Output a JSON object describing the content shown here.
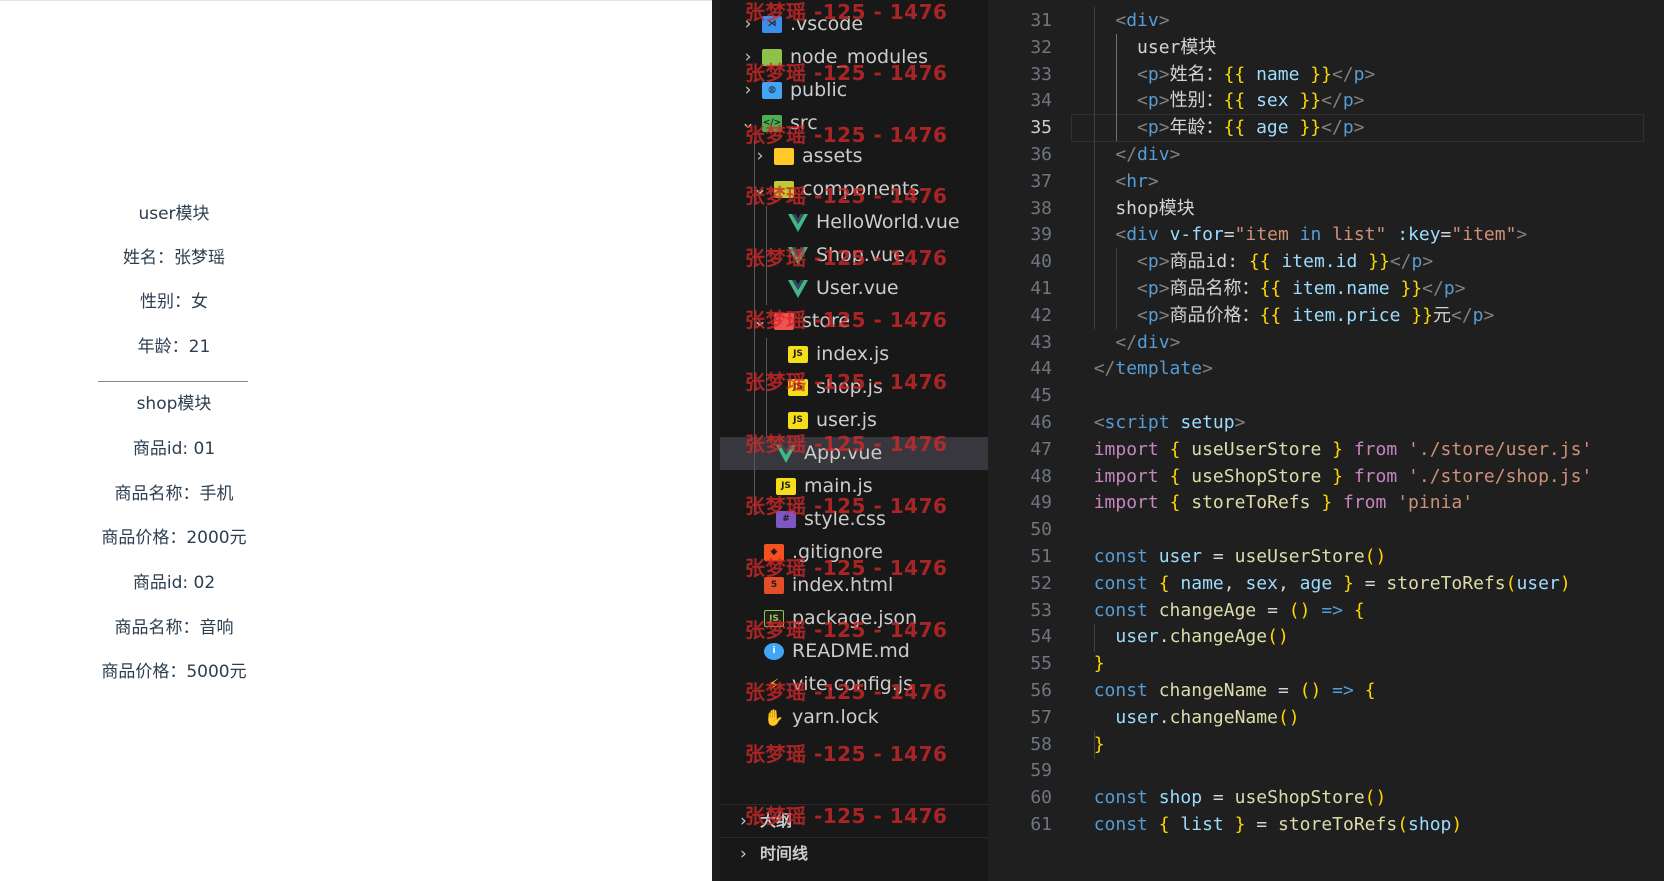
{
  "preview": {
    "lines": [
      "user模块",
      "姓名：张梦瑶",
      "性别：女",
      "年龄：21",
      "shop模块",
      "商品id: 01",
      "商品名称：手机",
      "商品价格：2000元",
      "商品id: 02",
      "商品名称：音响",
      "商品价格：5000元"
    ]
  },
  "explorer": {
    "items": [
      {
        "label": ".vscode",
        "icon": "vscode-folder-icon",
        "kind": "folder-collapsed",
        "depth": 0
      },
      {
        "label": "node_modules",
        "icon": "node-folder-icon",
        "kind": "folder-collapsed",
        "depth": 0
      },
      {
        "label": "public",
        "icon": "public-folder-icon",
        "kind": "folder-collapsed",
        "depth": 0
      },
      {
        "label": "src",
        "icon": "src-folder-icon",
        "kind": "folder-expanded",
        "depth": 0
      },
      {
        "label": "assets",
        "icon": "assets-folder-icon",
        "kind": "folder-collapsed",
        "depth": 1
      },
      {
        "label": "components",
        "icon": "components-folder-icon",
        "kind": "folder-expanded",
        "depth": 1
      },
      {
        "label": "HelloWorld.vue",
        "icon": "vue-file-icon",
        "kind": "file",
        "depth": 2
      },
      {
        "label": "Shop.vue",
        "icon": "vue-file-icon",
        "kind": "file",
        "depth": 2
      },
      {
        "label": "User.vue",
        "icon": "vue-file-icon",
        "kind": "file",
        "depth": 2
      },
      {
        "label": "store",
        "icon": "store-folder-icon",
        "kind": "folder-expanded",
        "depth": 1
      },
      {
        "label": "index.js",
        "icon": "js-file-icon",
        "kind": "file",
        "depth": 2
      },
      {
        "label": "shop.js",
        "icon": "js-file-icon",
        "kind": "file",
        "depth": 2
      },
      {
        "label": "user.js",
        "icon": "js-file-icon",
        "kind": "file",
        "depth": 2
      },
      {
        "label": "App.vue",
        "icon": "vue-file-icon",
        "kind": "file",
        "depth": 1,
        "selected": true
      },
      {
        "label": "main.js",
        "icon": "js-file-icon",
        "kind": "file",
        "depth": 1
      },
      {
        "label": "style.css",
        "icon": "css-file-icon",
        "kind": "file",
        "depth": 1
      },
      {
        "label": ".gitignore",
        "icon": "git-file-icon",
        "kind": "file",
        "depth": 0
      },
      {
        "label": "index.html",
        "icon": "html-file-icon",
        "kind": "file",
        "depth": 0
      },
      {
        "label": "package.json",
        "icon": "nodejs-file-icon",
        "kind": "file",
        "depth": 0
      },
      {
        "label": "README.md",
        "icon": "info-file-icon",
        "kind": "file",
        "depth": 0
      },
      {
        "label": "vite.config.js",
        "icon": "vite-file-icon",
        "kind": "file",
        "depth": 0
      },
      {
        "label": "yarn.lock",
        "icon": "yarn-file-icon",
        "kind": "file",
        "depth": 0
      }
    ],
    "sections": [
      "大纲",
      "时间线"
    ],
    "watermark": "张梦瑶 -125 - 1476"
  },
  "editor": {
    "active_line": 35,
    "lines": [
      {
        "n": 31,
        "text": "    <div>"
      },
      {
        "n": 32,
        "text": "      user模块"
      },
      {
        "n": 33,
        "text": "      <p>姓名：{{ name }}</p>"
      },
      {
        "n": 34,
        "text": "      <p>性别：{{ sex }}</p>"
      },
      {
        "n": 35,
        "text": "      <p>年龄：{{ age }}</p>"
      },
      {
        "n": 36,
        "text": "    </div>"
      },
      {
        "n": 37,
        "text": "    <hr>"
      },
      {
        "n": 38,
        "text": "    shop模块"
      },
      {
        "n": 39,
        "text": "    <div v-for=\"item in list\" :key=\"item\">"
      },
      {
        "n": 40,
        "text": "      <p>商品id: {{ item.id }}</p>"
      },
      {
        "n": 41,
        "text": "      <p>商品名称：{{ item.name }}</p>"
      },
      {
        "n": 42,
        "text": "      <p>商品价格：{{ item.price }}元</p>"
      },
      {
        "n": 43,
        "text": "    </div>"
      },
      {
        "n": 44,
        "text": "  </template>"
      },
      {
        "n": 45,
        "text": ""
      },
      {
        "n": 46,
        "text": "  <script setup>"
      },
      {
        "n": 47,
        "text": "  import { useUserStore } from './store/user.js'"
      },
      {
        "n": 48,
        "text": "  import { useShopStore } from './store/shop.js'"
      },
      {
        "n": 49,
        "text": "  import { storeToRefs } from 'pinia'"
      },
      {
        "n": 50,
        "text": ""
      },
      {
        "n": 51,
        "text": "  const user = useUserStore()"
      },
      {
        "n": 52,
        "text": "  const { name, sex, age } = storeToRefs(user)"
      },
      {
        "n": 53,
        "text": "  const changeAge = () => {"
      },
      {
        "n": 54,
        "text": "    user.changeAge()"
      },
      {
        "n": 55,
        "text": "  }"
      },
      {
        "n": 56,
        "text": "  const changeName = () => {"
      },
      {
        "n": 57,
        "text": "    user.changeName()"
      },
      {
        "n": 58,
        "text": "  }"
      },
      {
        "n": 59,
        "text": ""
      },
      {
        "n": 60,
        "text": "  const shop = useShopStore()"
      },
      {
        "n": 61,
        "text": "  const { list } = storeToRefs(shop)"
      }
    ]
  },
  "colors": {
    "explorer_bg": "#181818",
    "editor_bg": "#1f1f1f",
    "selected_row": "#37373d",
    "vue_green": "#41b883",
    "js_yellow": "#f5de19",
    "watermark_red": "#d22828"
  }
}
